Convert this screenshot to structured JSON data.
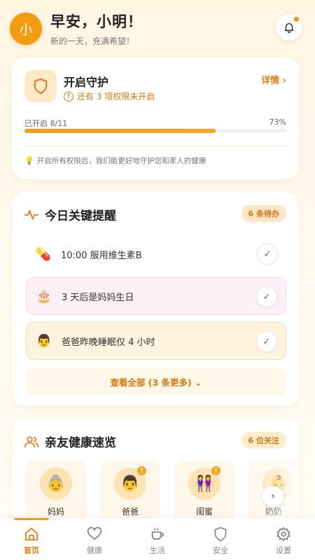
{
  "header": {
    "avatar_text": "小",
    "greeting": "早安，小明！",
    "subtitle": "新的一天，充满希望！"
  },
  "guard": {
    "title": "开启守护",
    "warning": "还有 3 项权限未开启",
    "detail_label": "详情",
    "progress_label": "已开启 8/11",
    "progress_percent_text": "73%",
    "progress_value": 0.73,
    "tip": "开启所有权限后，我们能更好地守护您和家人的健康"
  },
  "reminders": {
    "title": "今日关键提醒",
    "badge": "6 条待办",
    "items": [
      {
        "icon": "💊",
        "text": "10:00 服用维生素B"
      },
      {
        "icon": "🎂",
        "text": "3 天后是妈妈生日"
      },
      {
        "icon": "👨",
        "text": "爸爸昨晚睡眠仅 4 小时"
      }
    ],
    "view_all": "查看全部 (3 条更多) ⌄"
  },
  "health": {
    "title": "亲友健康速览",
    "badge": "6 位关注",
    "people": [
      {
        "icon": "👵",
        "name": "妈妈",
        "alert": false
      },
      {
        "icon": "👨",
        "name": "爸爸",
        "alert": true
      },
      {
        "icon": "👭",
        "name": "闺蜜",
        "alert": true
      },
      {
        "icon": "👶",
        "name": "奶奶",
        "alert": false
      }
    ]
  },
  "tabs": [
    {
      "label": "首页",
      "active": true
    },
    {
      "label": "健康",
      "active": false
    },
    {
      "label": "生活",
      "active": false
    },
    {
      "label": "安全",
      "active": false
    },
    {
      "label": "设置",
      "active": false
    }
  ],
  "colors": {
    "accent": "#f39c12",
    "accent_text": "#e07f14"
  }
}
